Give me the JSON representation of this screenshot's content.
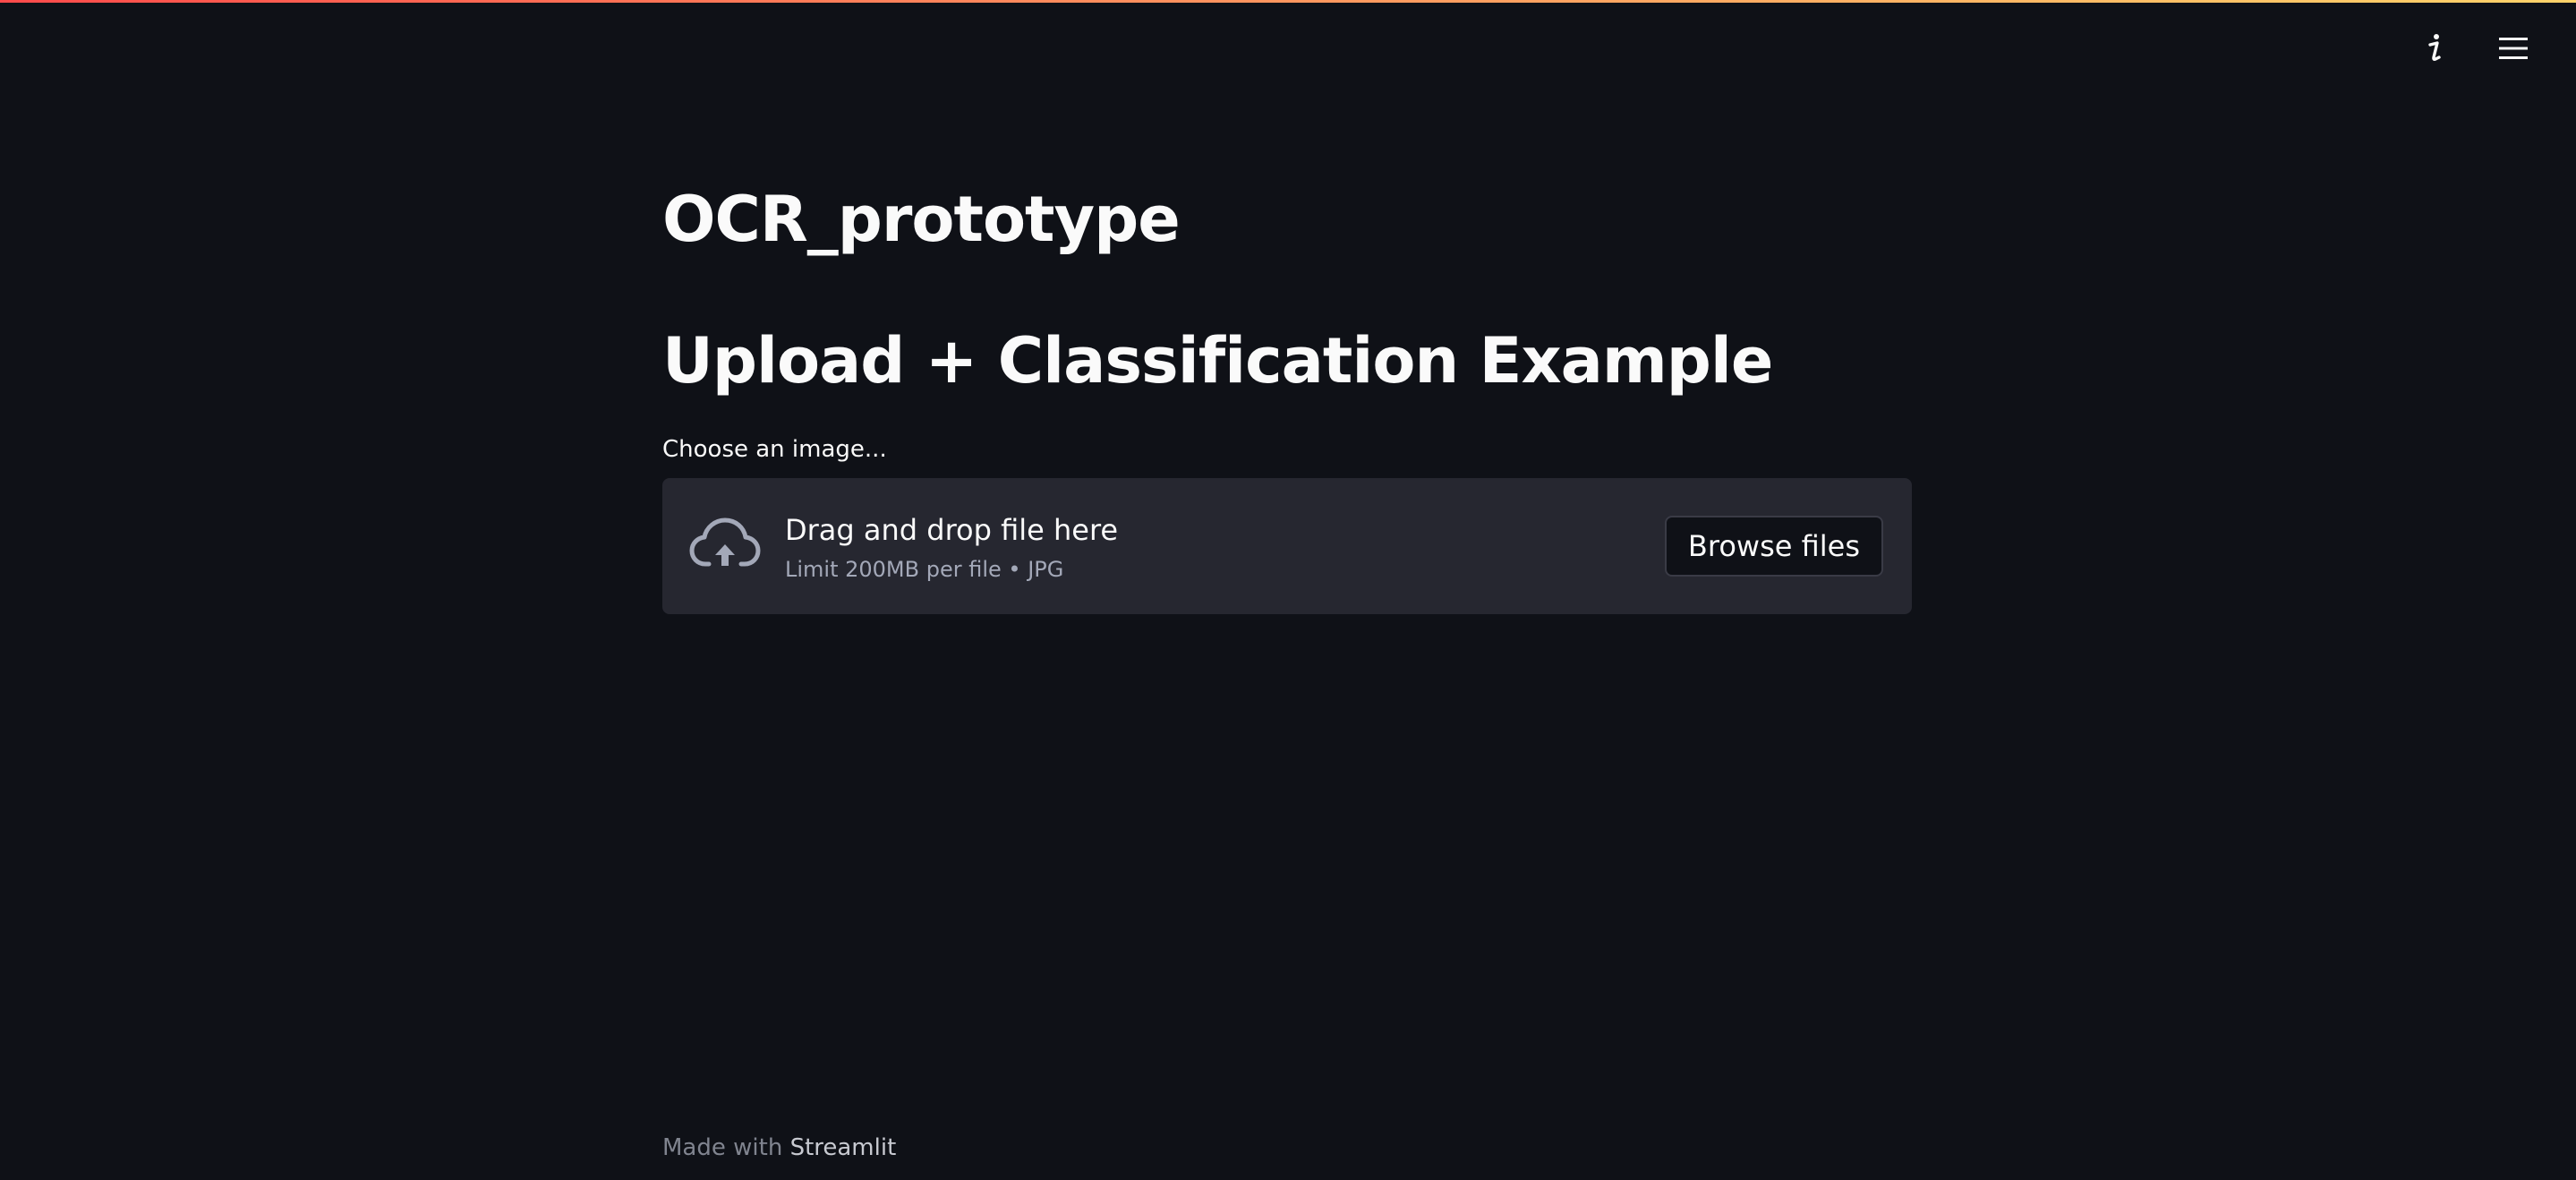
{
  "colors": {
    "background": "#0f1117",
    "surface": "#262730",
    "text": "#fafafa",
    "muted_text": "#a3a8b8",
    "accent_gradient_start": "#ff4b4b",
    "accent_gradient_end": "#ffd36a"
  },
  "toolbar": {
    "about_icon": "info-icon",
    "menu_icon": "hamburger-menu-icon"
  },
  "main": {
    "title": "OCR_prototype",
    "subtitle": "Upload + Classification Example",
    "uploader": {
      "label": "Choose an image...",
      "icon": "cloud-upload-icon",
      "instructions": "Drag and drop file here",
      "limits": "Limit 200MB per file • JPG",
      "browse_label": "Browse files"
    }
  },
  "footer": {
    "made_with": "Made with",
    "brand": "Streamlit"
  }
}
